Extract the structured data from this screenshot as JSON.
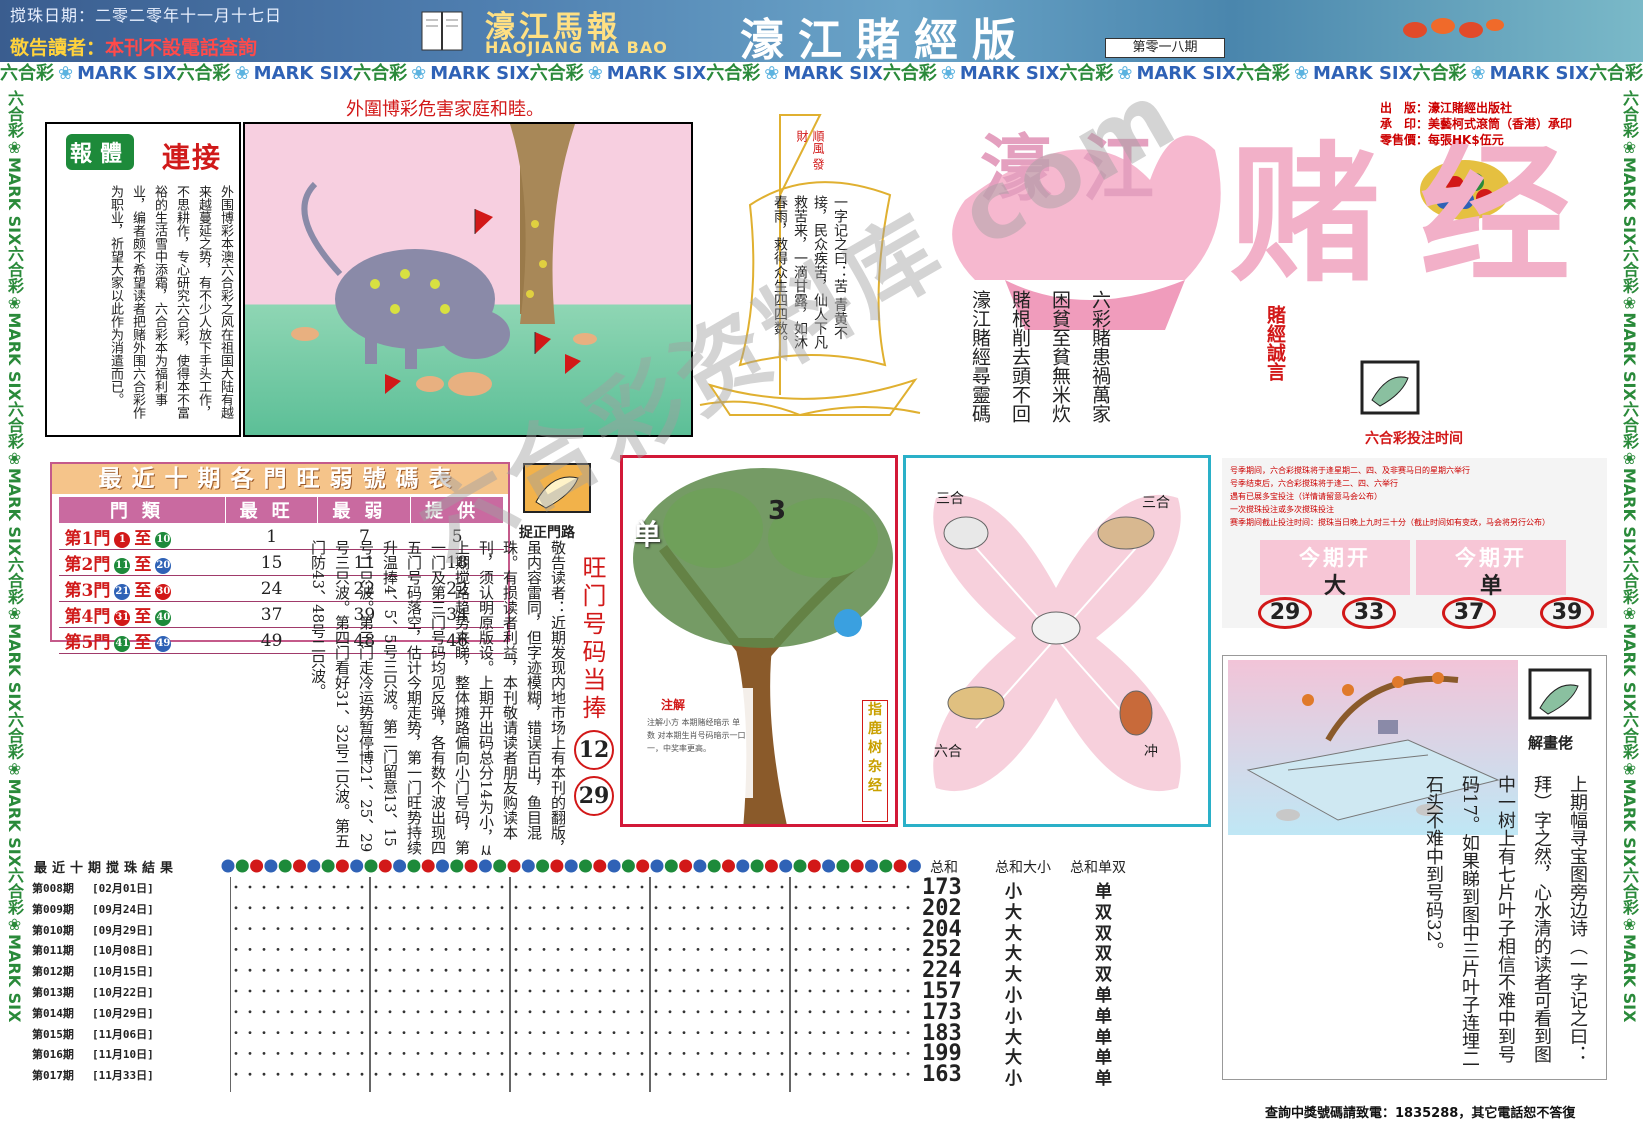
{
  "header": {
    "date": "搅珠日期：二零二零年十一月十七日",
    "notice_a": "敬告讀者：",
    "notice_b": "本刊不設電話查詢",
    "brand_cn": "濠江馬報",
    "brand_en": "HAOJIANG MA BAO",
    "edition": "濠江賭經版",
    "issue": "第零一八期"
  },
  "strip": {
    "cn": "六合彩",
    "en": "MARK SIX",
    "repeat": 10
  },
  "warning": "外圍博彩危害家庭和睦。",
  "link": {
    "badge": "報體",
    "title": "連接",
    "text": "外围博彩本澳六合彩之风在祖国大陆有越来越蔓延之势，有不少人放下手头工作，不思耕作，专心研究六合彩，使得本不富裕的生活雪中添霜，六合彩本为福利事业，编者颇不希望读者把赌外围六合彩作为职业，祈望大家以此作为消遣而已。"
  },
  "sail": {
    "flag": "順風 發財",
    "text": "一字记之曰：苦 青黄不接，民众疾苦，仙人下凡救苦来，一滴甘露，如沐春雨，救得众生四四数。"
  },
  "poem": {
    "lines": [
      "六彩賭患禍萬家",
      "困貧至貧無米炊",
      "賭根削去頭不回",
      "濠江賭經尋靈碼"
    ],
    "note": "賭經誠言"
  },
  "title": {
    "line1": "濠江",
    "line2": "赌经"
  },
  "publisher": {
    "l1": "出　版：濠江賭經出版社",
    "l2": "承　印：美藝柯式滾筒（香港）承印",
    "l3": "零售價：每張HK$伍元"
  },
  "time_label": "六合彩投注时间",
  "ten_table": {
    "title": "最近十期各門旺弱號碼表",
    "headers": [
      "門類",
      "最旺",
      "最弱",
      "提供"
    ],
    "rows": [
      {
        "gate": "第1門",
        "from": "1",
        "to": "10",
        "hot": "1",
        "cold": "7",
        "tip": "5"
      },
      {
        "gate": "第2門",
        "from": "11",
        "to": "20",
        "hot": "15",
        "cold": "11",
        "tip": "18"
      },
      {
        "gate": "第3門",
        "from": "21",
        "to": "30",
        "hot": "24",
        "cold": "22",
        "tip": "22"
      },
      {
        "gate": "第4門",
        "from": "31",
        "to": "40",
        "hot": "37",
        "cold": "39",
        "tip": "34"
      },
      {
        "gate": "第5門",
        "from": "41",
        "to": "49",
        "hot": "49",
        "cold": "48",
        "tip": "46"
      }
    ],
    "to_word": "至"
  },
  "gate_tip": {
    "label": "捉正門路",
    "head": "旺门号码当捧",
    "n1": "12",
    "n2": "29"
  },
  "article": "敬告读者：近期发现内地市场上有本刊的翻版，虽内容雷同，但字迹模糊，错误百出，鱼目混珠。有损读者利益，本刊敬请读者朋友购读本刊，须认明原版设。上期开出码总分14为小，从上期搅路趋势来睇，整体摊路偏向小门号码，第一门及第三门号码均见反弹，各有数个波出现四五门号码落空，估计今期走势，第一门旺势持续升温捧4、5、5号三只波。第二门留意13、15号二只波。第三门走冷运势暂停博21、25、29号三只波。第四门看好31、32号二只波。第五门防43、48号二只波。",
  "tree": {
    "label": "指鹿树杂经",
    "left_char": "单",
    "top_char": "3",
    "caption_title": "注解",
    "caption": "注解小方 本期赌经暗示 单数 对本期生肖号码暗示一口一，中奖率更高。"
  },
  "zodiac": {
    "tl": "三合",
    "tr": "三合",
    "bl": "六合",
    "br": "冲"
  },
  "open": {
    "rules": [
      "号季期间，六合彩搅珠将于逢星期二、四、及非赛马日的星期六举行",
      "号季结束后，六合彩搅珠将于逢二、四、六举行",
      "遇有已展多宝投注（详情请留意马会公布）",
      "一次搅珠投注或多次搅珠投注",
      "赛季期间截止投注时间：搅珠当日晚上九时三十分（截止时间如有变改，马会将另行公布）"
    ],
    "box1_head": "今期开",
    "box1_val": "大",
    "box2_head": "今期开",
    "box2_val": "单",
    "nums": [
      "29",
      "33",
      "37",
      "39"
    ]
  },
  "riddle": {
    "label": "解畫佬",
    "text": "上期幅寻宝图旁边诗（一字记之曰：拜）字之然，心水清的读者可看到图中一树上有七片叶子相信不难中到号码17。如果睇到图中三片叶子连埋二石头不难中到号码32。"
  },
  "chart": {
    "title": "最近十期搅珠結果",
    "head_sum": "总和",
    "head_size": "总和大小",
    "head_parity": "总和单双",
    "rows": [
      {
        "issue": "第008期",
        "date": "[02月01日]",
        "sum": "173",
        "size": "小",
        "parity": "单"
      },
      {
        "issue": "第009期",
        "date": "[09月24日]",
        "sum": "202",
        "size": "大",
        "parity": "双"
      },
      {
        "issue": "第010期",
        "date": "[09月29日]",
        "sum": "204",
        "size": "大",
        "parity": "双"
      },
      {
        "issue": "第011期",
        "date": "[10月08日]",
        "sum": "252",
        "size": "大",
        "parity": "双"
      },
      {
        "issue": "第012期",
        "date": "[10月15日]",
        "sum": "224",
        "size": "大",
        "parity": "双"
      },
      {
        "issue": "第013期",
        "date": "[10月22日]",
        "sum": "157",
        "size": "小",
        "parity": "单"
      },
      {
        "issue": "第014期",
        "date": "[10月29日]",
        "sum": "173",
        "size": "小",
        "parity": "单"
      },
      {
        "issue": "第015期",
        "date": "[11月06日]",
        "sum": "183",
        "size": "大",
        "parity": "单"
      },
      {
        "issue": "第016期",
        "date": "[11月10日]",
        "sum": "199",
        "size": "大",
        "parity": "单"
      },
      {
        "issue": "第017期",
        "date": "[11月33日]",
        "sum": "163",
        "size": "小",
        "parity": "单"
      }
    ]
  },
  "footer": {
    "query": "查詢中獎號碼請致電：1835288，其它電話恕不答復"
  },
  "watermark": "六合彩资料库 com",
  "colors": {
    "header_blue": "#3a5d8f",
    "accent_red": "#d21818",
    "strip_green": "#2a8a3a",
    "strip_blue": "#2f62b6",
    "pink": "#f7c6d6"
  }
}
